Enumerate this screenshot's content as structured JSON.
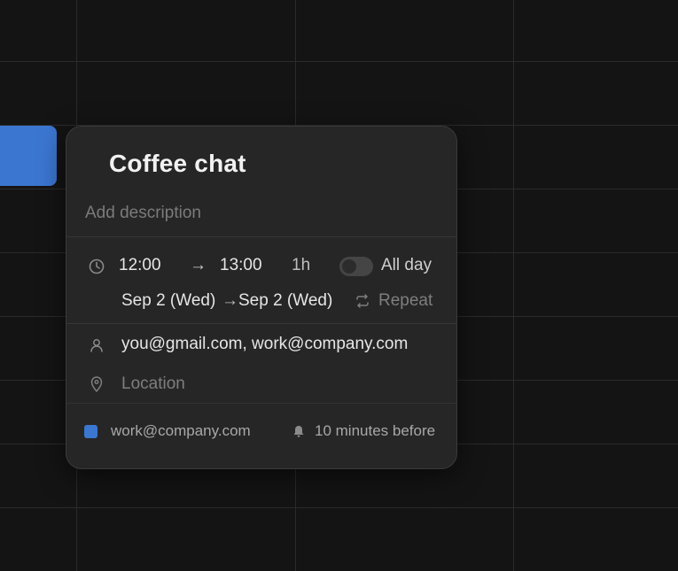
{
  "event": {
    "title": "Coffee chat",
    "description_placeholder": "Add description",
    "start_time": "12:00",
    "arrow": "→",
    "end_time": "13:00",
    "duration": "1h",
    "all_day_label": "All day",
    "all_day": false,
    "start_date": "Sep 2 (Wed)",
    "date_arrow": "→",
    "end_date": "Sep 2 (Wed)",
    "repeat_label": "Repeat",
    "attendees": "you@gmail.com, work@company.com",
    "location_placeholder": "Location",
    "calendar": "work@company.com",
    "calendar_color": "#3b76d0",
    "reminder": "10 minutes before"
  },
  "icons": {
    "clock": "clock-icon",
    "repeat": "repeat-icon",
    "person": "person-icon",
    "location": "location-pin-icon",
    "bell": "bell-icon"
  }
}
